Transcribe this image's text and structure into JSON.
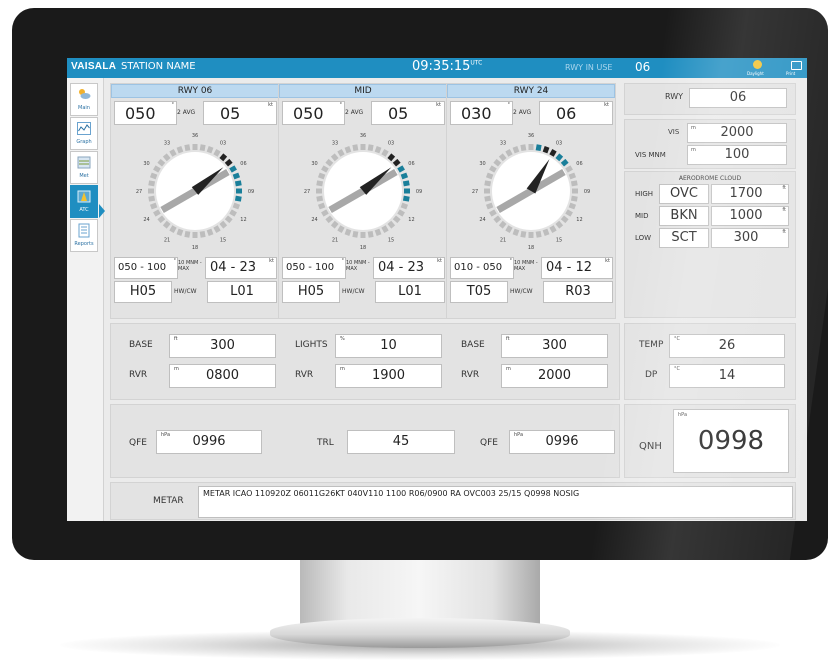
{
  "app": {
    "brand": "VAISALA",
    "station_name": "STATION NAME",
    "time": "09:35:15",
    "time_suffix": "UTC",
    "rwy_in_use_label": "RWY IN USE",
    "rwy_in_use": "06",
    "daylight_label": "Daylight",
    "print_label": "Print"
  },
  "sidebar": {
    "items": [
      {
        "label": "Main"
      },
      {
        "label": "Graph"
      },
      {
        "label": "Met"
      },
      {
        "label": "ATC",
        "active": true
      },
      {
        "label": "Reports"
      }
    ]
  },
  "runways": [
    {
      "title": "RWY 06",
      "dir": "050",
      "avg_label": "2 AVG",
      "speed": "05",
      "speed_unit": "kt",
      "deg_unit": "°",
      "range": "050 - 100",
      "range_unit": "°",
      "mnm_max": "10 MNM - MAX",
      "gust": "04 - 23",
      "gust_unit": "kt",
      "hw": "H05",
      "hwcw_label": "HW/CW",
      "cw": "L01",
      "arrow_deg": 50
    },
    {
      "title": "MID",
      "dir": "050",
      "avg_label": "2 AVG",
      "speed": "05",
      "speed_unit": "kt",
      "deg_unit": "°",
      "range": "050 - 100",
      "range_unit": "°",
      "mnm_max": "10 MNM - MAX",
      "gust": "04 - 23",
      "gust_unit": "kt",
      "hw": "H05",
      "hwcw_label": "HW/CW",
      "cw": "L01",
      "arrow_deg": 50
    },
    {
      "title": "RWY 24",
      "dir": "030",
      "avg_label": "2 AVG",
      "speed": "06",
      "speed_unit": "kt",
      "deg_unit": "°",
      "range": "010 - 050",
      "range_unit": "°",
      "mnm_max": "10 MNM - MAX",
      "gust": "04 - 12",
      "gust_unit": "kt",
      "hw": "T05",
      "hwcw_label": "HW/CW",
      "cw": "R03",
      "arrow_deg": 30
    }
  ],
  "dial_ticks": [
    "36",
    "03",
    "06",
    "09",
    "12",
    "15",
    "18",
    "21",
    "24",
    "27",
    "30",
    "33"
  ],
  "right": {
    "rwy_label": "RWY",
    "rwy": "06",
    "vis_label": "VIS",
    "vis_unit": "m",
    "vis": "2000",
    "vis_mnm_label": "VIS MNM",
    "vis_mnm_unit": "m",
    "vis_mnm": "100",
    "cloud_title": "AERODROME CLOUD",
    "clouds": [
      {
        "level": "HIGH",
        "cover": "OVC",
        "height": "1700",
        "unit": "ft"
      },
      {
        "level": "MID",
        "cover": "BKN",
        "height": "1000",
        "unit": "ft"
      },
      {
        "level": "LOW",
        "cover": "SCT",
        "height": "300",
        "unit": "ft"
      }
    ]
  },
  "row1": {
    "cols": [
      {
        "l1": "BASE",
        "u1": "ft",
        "v1": "300",
        "l2": "RVR",
        "u2": "m",
        "v2": "0800"
      },
      {
        "l1": "LIGHTS",
        "u1": "%",
        "v1": "10",
        "l2": "RVR",
        "u2": "m",
        "v2": "1900"
      },
      {
        "l1": "BASE",
        "u1": "ft",
        "v1": "300",
        "l2": "RVR",
        "u2": "m",
        "v2": "2000"
      }
    ],
    "temp_label": "TEMP",
    "temp_unit": "°C",
    "temp": "26",
    "dp_label": "DP",
    "dp_unit": "°C",
    "dp": "14"
  },
  "row2": {
    "qfe1_label": "QFE",
    "qfe1_unit": "hPa",
    "qfe1": "0996",
    "trl_label": "TRL",
    "trl": "45",
    "qfe2_label": "QFE",
    "qfe2_unit": "hPa",
    "qfe2": "0996",
    "qnh_label": "QNH",
    "qnh_unit": "hPa",
    "qnh": "0998"
  },
  "metar": {
    "label": "METAR",
    "text": "METAR ICAO 110920Z 06011G26KT 040V110 1100 R06/0900 RA  OVC003 25/15 Q0998 NOSIG"
  },
  "colors": {
    "accent": "#1f8ec1",
    "wind_teal": "#1a7f9a",
    "arrow": "#222222",
    "runway_bar": "#a8a8a8"
  }
}
